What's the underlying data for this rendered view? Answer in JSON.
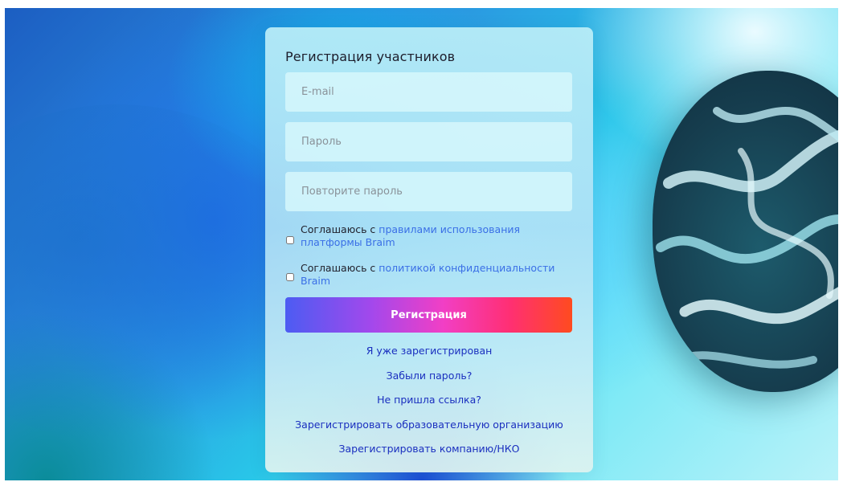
{
  "form": {
    "title": "Регистрация участников",
    "email_placeholder": "E-mail",
    "password_placeholder": "Пароль",
    "repeat_password_placeholder": "Повторите пароль",
    "terms": {
      "prefix": "Соглашаюсь с ",
      "link": "правилами использования платформы Braim"
    },
    "privacy": {
      "prefix": "Соглашаюсь с ",
      "link": "политикой конфиденциальности Braim"
    },
    "submit_label": "Регистрация"
  },
  "links": [
    {
      "label": "Я уже зарегистрирован"
    },
    {
      "label": "Забыли пароль?"
    },
    {
      "label": "Не пришла ссылка?"
    },
    {
      "label": "Зарегистрировать образовательную организацию"
    },
    {
      "label": "Зарегистрировать компанию/НКО"
    }
  ],
  "colors": {
    "link": "#1a2fbf",
    "inline_link": "#3a6fe6",
    "button_gradient_start": "#4c5cf2",
    "button_gradient_end": "#ff4b1f"
  }
}
